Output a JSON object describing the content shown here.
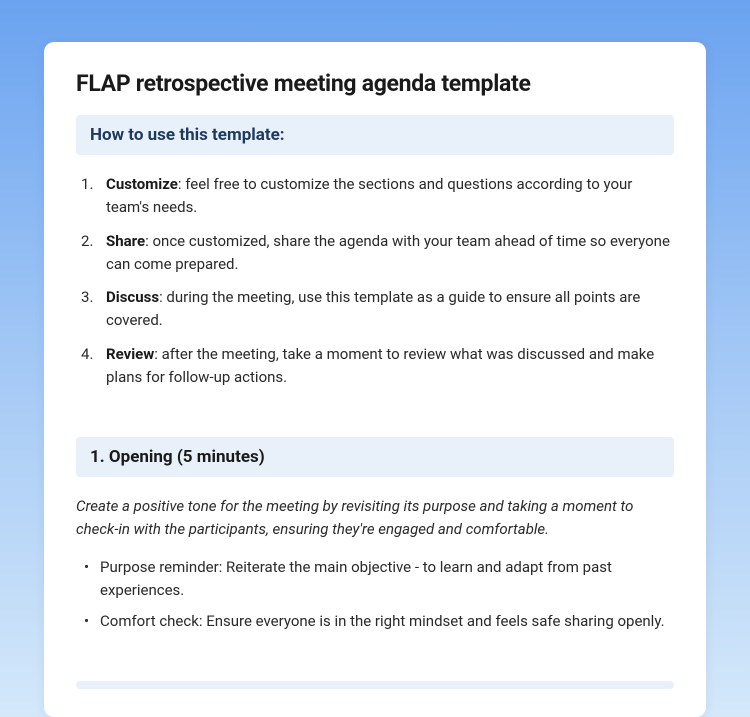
{
  "title": "FLAP retrospective meeting agenda template",
  "how_to": {
    "heading": "How to use this template:",
    "steps": [
      {
        "bold": "Customize",
        "text": ": feel free to customize the sections and questions according to your team's needs."
      },
      {
        "bold": "Share",
        "text": ": once customized, share the agenda with your team ahead of time so everyone can come prepared."
      },
      {
        "bold": "Discuss",
        "text": ": during the meeting, use this template as a guide to ensure all points are covered."
      },
      {
        "bold": "Review",
        "text": ": after the meeting, take a moment to review what was discussed and make plans for follow-up actions."
      }
    ]
  },
  "section1": {
    "heading": "1. Opening (5 minutes)",
    "intro": "Create a positive tone for the meeting by revisiting its purpose and taking a moment to check-in with the participants, ensuring they're engaged and comfortable.",
    "bullets": [
      "Purpose reminder: Reiterate the main objective - to learn and adapt from past experiences.",
      "Comfort check: Ensure everyone is in the right mindset and feels safe sharing openly."
    ]
  }
}
